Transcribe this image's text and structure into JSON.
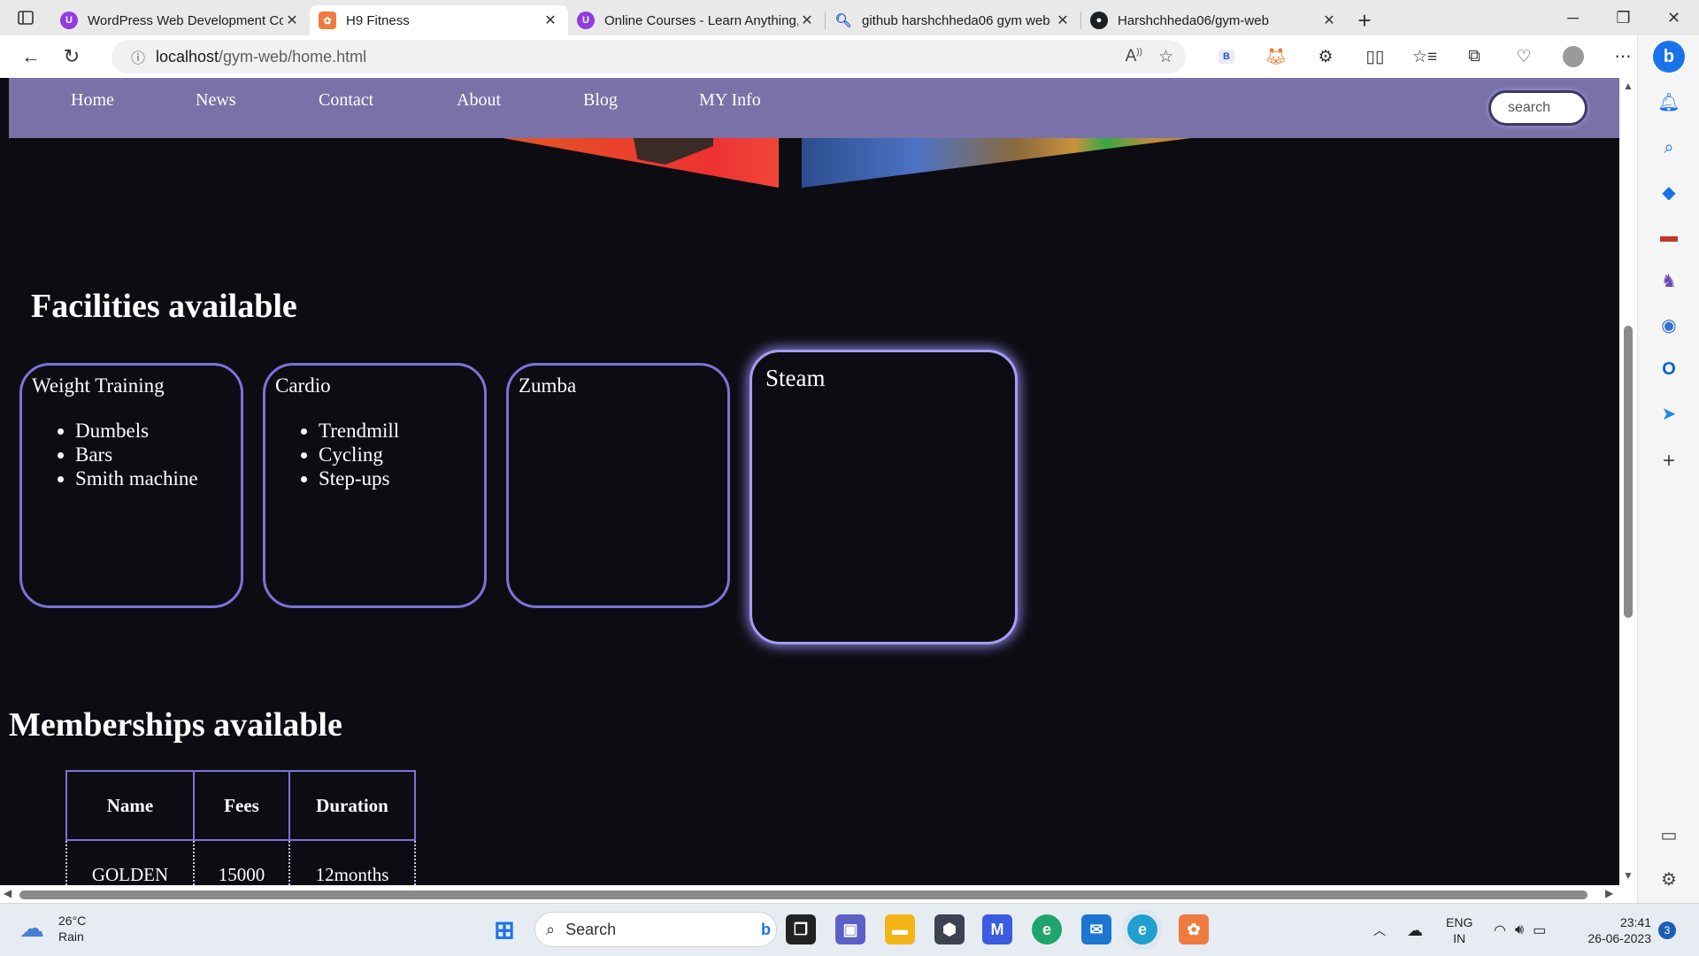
{
  "browser": {
    "tabs": [
      {
        "title": "WordPress Web Development Co",
        "icon": "udemy-icon",
        "active": false
      },
      {
        "title": "H9 Fitness",
        "icon": "xampp-icon",
        "active": true
      },
      {
        "title": "Online Courses - Learn Anything,",
        "icon": "udemy-icon",
        "active": false
      },
      {
        "title": "github harshchheda06 gym web",
        "icon": "search-icon",
        "active": false
      },
      {
        "title": "Harshchheda06/gym-web",
        "icon": "github-icon",
        "active": false
      }
    ],
    "url_host": "localhost",
    "url_path": "/gym-web/home.html"
  },
  "page": {
    "nav": [
      "Home",
      "News",
      "Contact",
      "About",
      "Blog",
      "MY Info"
    ],
    "search_placeholder": "search",
    "facilities_heading": "Facilities available",
    "facilities": [
      {
        "title": "Weight Training",
        "items": [
          "Dumbels",
          "Bars",
          "Smith machine"
        ]
      },
      {
        "title": "Cardio",
        "items": [
          "Trendmill",
          "Cycling",
          "Step-ups"
        ]
      },
      {
        "title": "Zumba",
        "items": []
      },
      {
        "title": "Steam",
        "items": []
      }
    ],
    "memberships_heading": "Memberships available",
    "table": {
      "headers": [
        "Name",
        "Fees",
        "Duration"
      ],
      "rows": [
        [
          "GOLDEN",
          "15000",
          "12months"
        ]
      ]
    }
  },
  "taskbar": {
    "weather_temp": "26°C",
    "weather_desc": "Rain",
    "search_label": "Search",
    "lang_top": "ENG",
    "lang_bottom": "IN",
    "time": "23:41",
    "date": "26-06-2023",
    "notification_count": "3"
  },
  "colors": {
    "navbar": "#7971a8",
    "page_bg": "#0e0c13",
    "card_border": "#7d72d8"
  }
}
